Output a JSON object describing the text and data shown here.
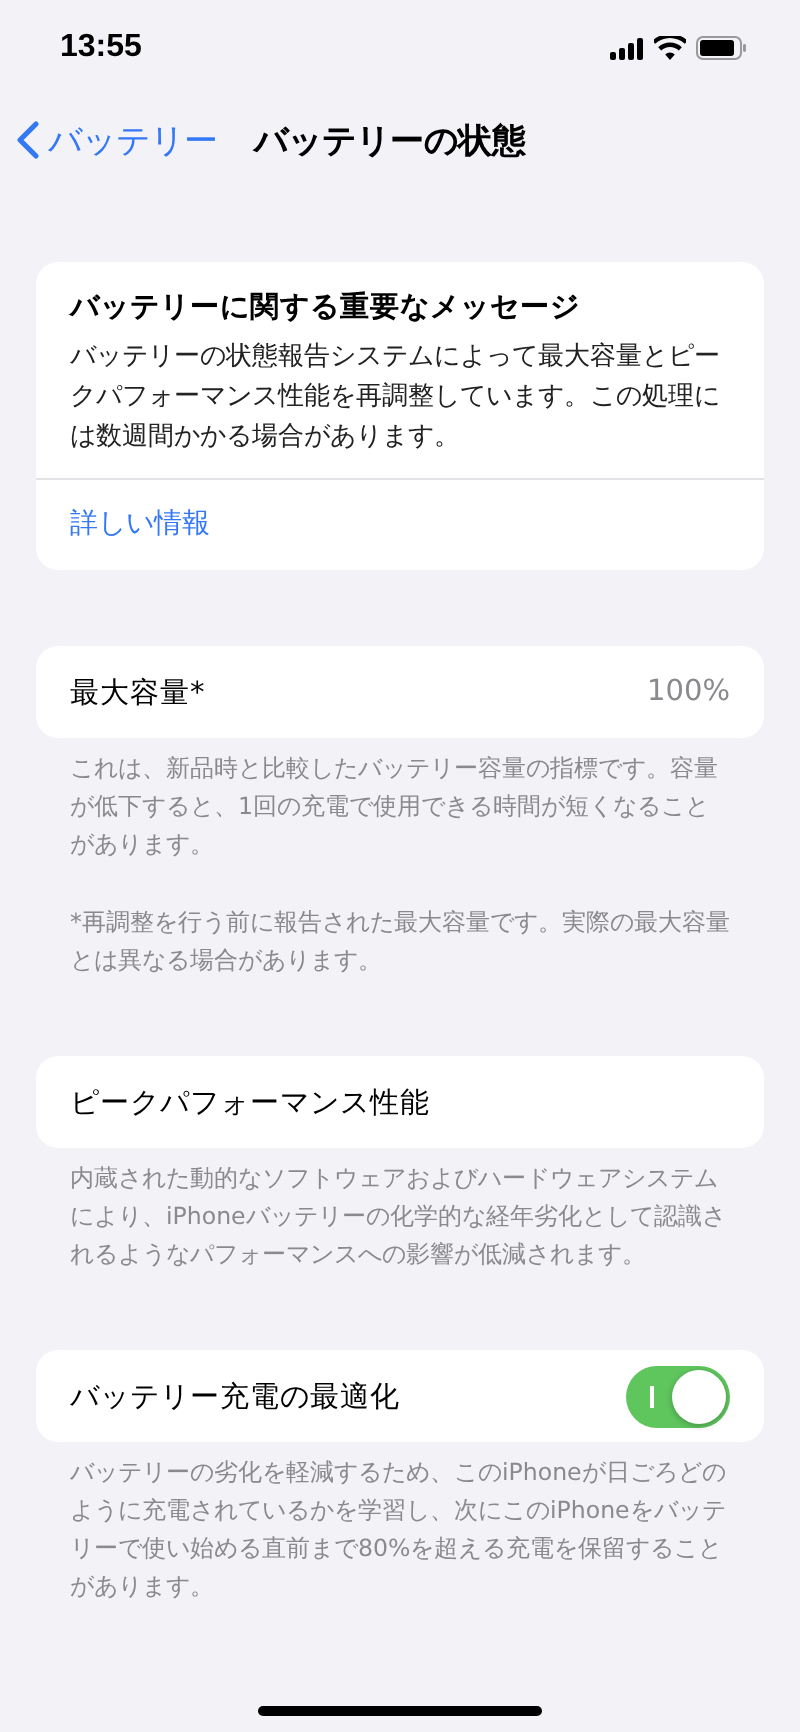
{
  "status_bar": {
    "time": "13:55"
  },
  "nav": {
    "back": "バッテリー",
    "title": "バッテリーの状態"
  },
  "message": {
    "title": "バッテリーに関する重要なメッセージ",
    "body": "バッテリーの状態報告システムによって最大容量とピークパフォーマンス性能を再調整しています。この処理には数週間かかる場合があります。",
    "link": "詳しい情報"
  },
  "sections": [
    {
      "kind": "value",
      "label": "最大容量*",
      "value": "100%",
      "footer": [
        "これは、新品時と比較したバッテリー容量の指標です。容量が低下すると、1回の充電で使用できる時間が短くなることがあります。",
        "*再調整を行う前に報告された最大容量です。実際の最大容量とは異なる場合があります。"
      ]
    },
    {
      "kind": "plain",
      "label": "ピークパフォーマンス性能",
      "footer": [
        "内蔵された動的なソフトウェアおよびハードウェアシステムにより、iPhoneバッテリーの化学的な経年劣化として認識されるようなパフォーマンスへの影響が低減されます。"
      ]
    },
    {
      "kind": "toggle",
      "label": "バッテリー充電の最適化",
      "on": true,
      "footer": [
        "バッテリーの劣化を軽減するため、このiPhoneが日ごろどのように充電されているかを学習し、次にこのiPhoneをバッテリーで使い始める直前まで80%を超える充電を保留することがあります。"
      ]
    }
  ]
}
